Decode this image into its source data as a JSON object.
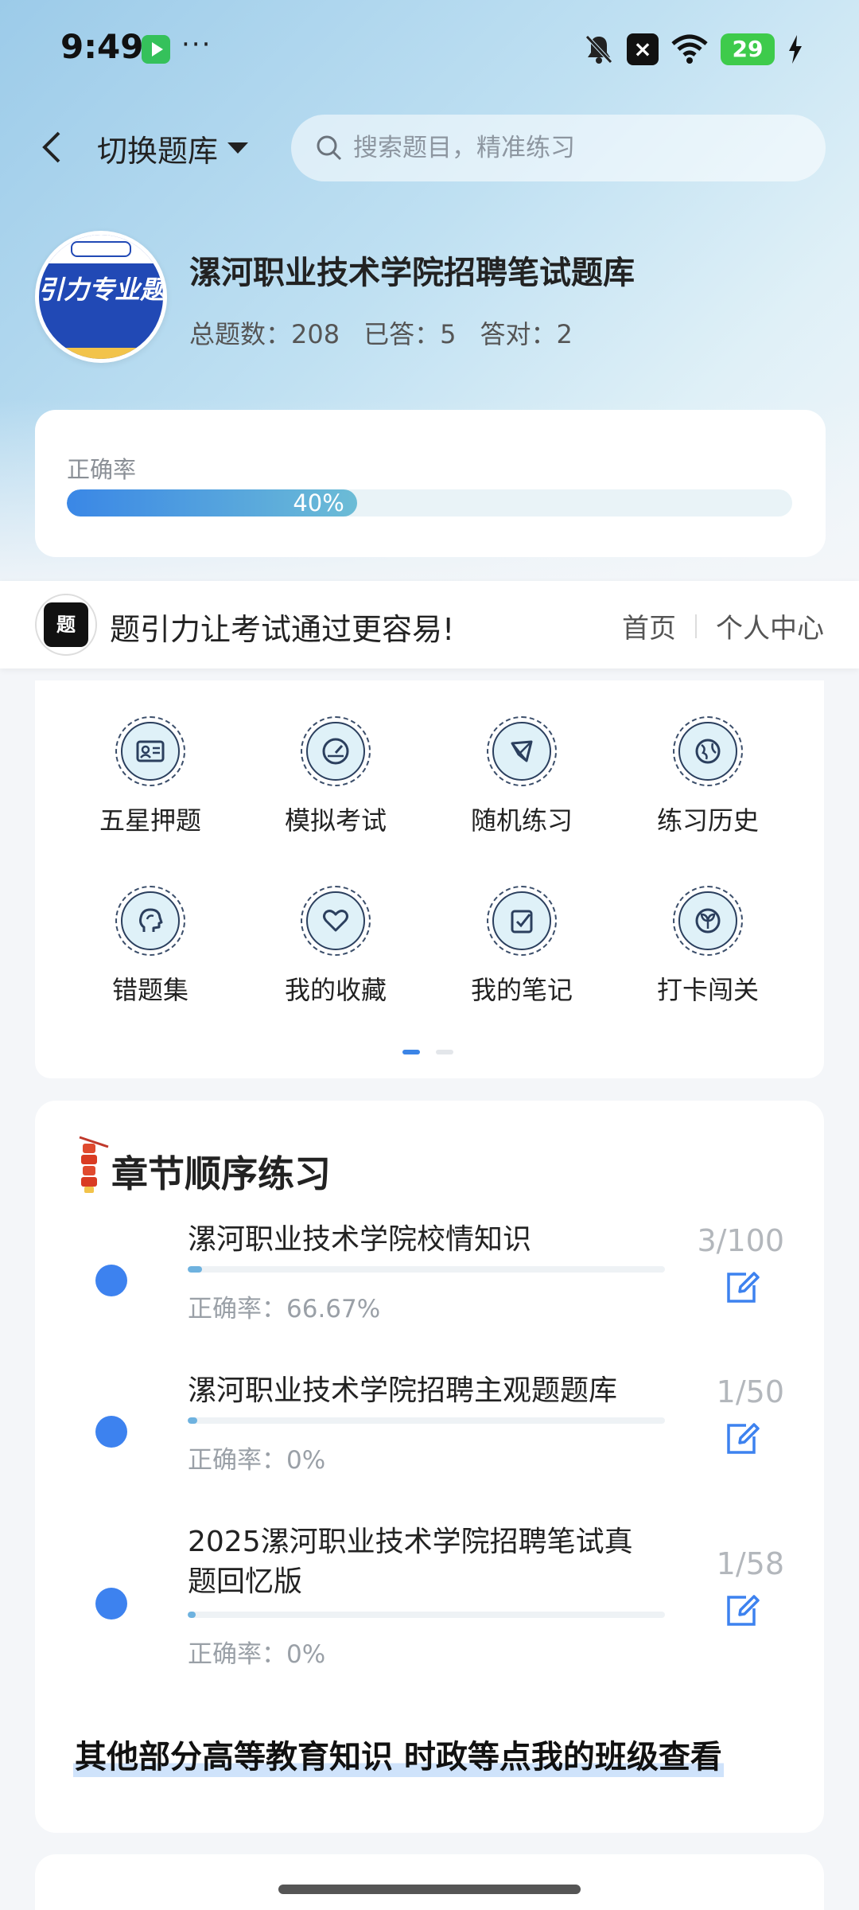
{
  "status_bar": {
    "time": "9:49",
    "dots": "···",
    "battery": "29"
  },
  "header": {
    "switch_label": "切换题库",
    "search_placeholder": "搜索题目，精准练习"
  },
  "bank": {
    "logo_text": "引力专业题",
    "title": "漯河职业技术学院招聘笔试题库",
    "total_label": "总题数：208",
    "answered_label": "已答：5",
    "correct_label": "答对：2"
  },
  "accuracy": {
    "label": "正确率",
    "percent_text": "40%",
    "percent": 0.4
  },
  "slogan": {
    "text": "题引力让考试通过更容易!",
    "nav_home": "首页",
    "nav_profile": "个人中心"
  },
  "features": [
    {
      "label": "五星押题",
      "icon": "id-card-icon"
    },
    {
      "label": "模拟考试",
      "icon": "gauge-icon"
    },
    {
      "label": "随机练习",
      "icon": "shuffle-icon"
    },
    {
      "label": "练习历史",
      "icon": "globe-icon"
    },
    {
      "label": "错题集",
      "icon": "head-icon"
    },
    {
      "label": "我的收藏",
      "icon": "heart-icon"
    },
    {
      "label": "我的笔记",
      "icon": "note-check-icon"
    },
    {
      "label": "打卡闯关",
      "icon": "sprout-icon"
    }
  ],
  "chapters": {
    "title": "章节顺序练习",
    "items": [
      {
        "name": "漯河职业技术学院校情知识",
        "accuracy": "正确率：66.67%",
        "count": "3/100",
        "progress": 0.03
      },
      {
        "name": "漯河职业技术学院招聘主观题题库",
        "accuracy": "正确率：0%",
        "count": "1/50",
        "progress": 0.02
      },
      {
        "name": "2025漯河职业技术学院招聘笔试真题回忆版",
        "accuracy": "正确率：0%",
        "count": "1/58",
        "progress": 0.017
      }
    ],
    "footer_link": "其他部分高等教育知识 时政等点我的班级查看"
  },
  "colors": {
    "accent": "#3d82ef",
    "logo_blue": "#2149b5"
  }
}
